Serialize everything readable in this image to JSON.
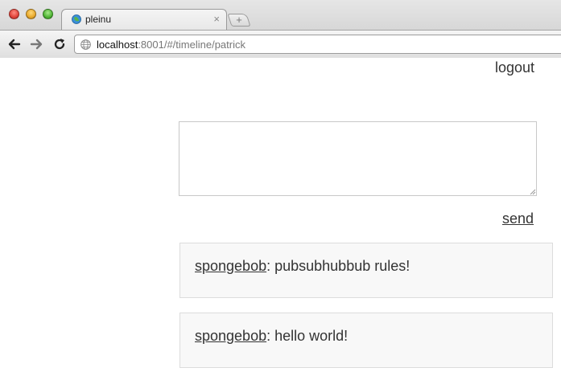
{
  "browser": {
    "tab_title": "pleinu",
    "tab_close": "×",
    "new_tab": "+",
    "url_host": "localhost",
    "url_rest": ":8001/#/timeline/patrick"
  },
  "header": {
    "logout_label": "logout"
  },
  "composer": {
    "value": "",
    "send_label": "send"
  },
  "timeline": {
    "posts": [
      {
        "author": "spongebob",
        "separator": ": ",
        "text": "pubsubhubbub rules!"
      },
      {
        "author": "spongebob",
        "separator": ": ",
        "text": "hello world!"
      }
    ]
  }
}
